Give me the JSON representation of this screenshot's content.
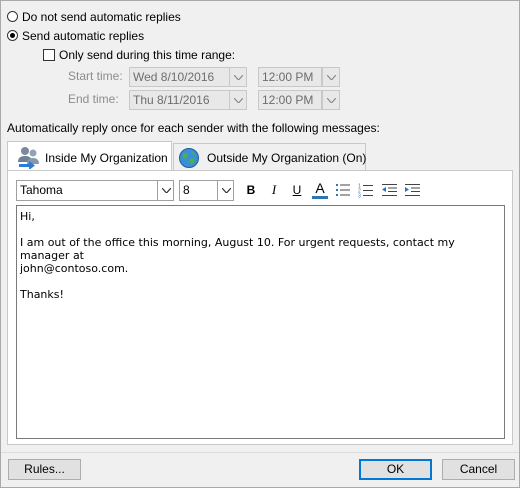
{
  "options": {
    "no_replies_label": "Do not send automatic replies",
    "send_replies_label": "Send automatic replies",
    "time_range_label": "Only send during this time range:"
  },
  "time_range": {
    "start_label": "Start time:",
    "start_date": "Wed 8/10/2016",
    "start_time": "12:00 PM",
    "end_label": "End time:",
    "end_date": "Thu 8/11/2016",
    "end_time": "12:00 PM"
  },
  "instruction": "Automatically reply once for each sender with the following messages:",
  "tabs": [
    {
      "label": "Inside My Organization",
      "icon": "people-icon",
      "active": true
    },
    {
      "label": "Outside My Organization (On)",
      "icon": "globe-icon",
      "active": false
    }
  ],
  "toolbar": {
    "font_name": "Tahoma",
    "font_size": "8",
    "bold": "B",
    "italic": "I",
    "underline": "U",
    "font_color": "A",
    "font_color_value": "#2e75b6"
  },
  "message": {
    "lines": [
      "Hi,",
      "",
      "I am out of the office this morning, August 10. For urgent requests, contact my manager at",
      "john@contoso.com.",
      "",
      "Thanks!"
    ]
  },
  "footer": {
    "rules_label": "Rules...",
    "ok_label": "OK",
    "cancel_label": "Cancel"
  }
}
